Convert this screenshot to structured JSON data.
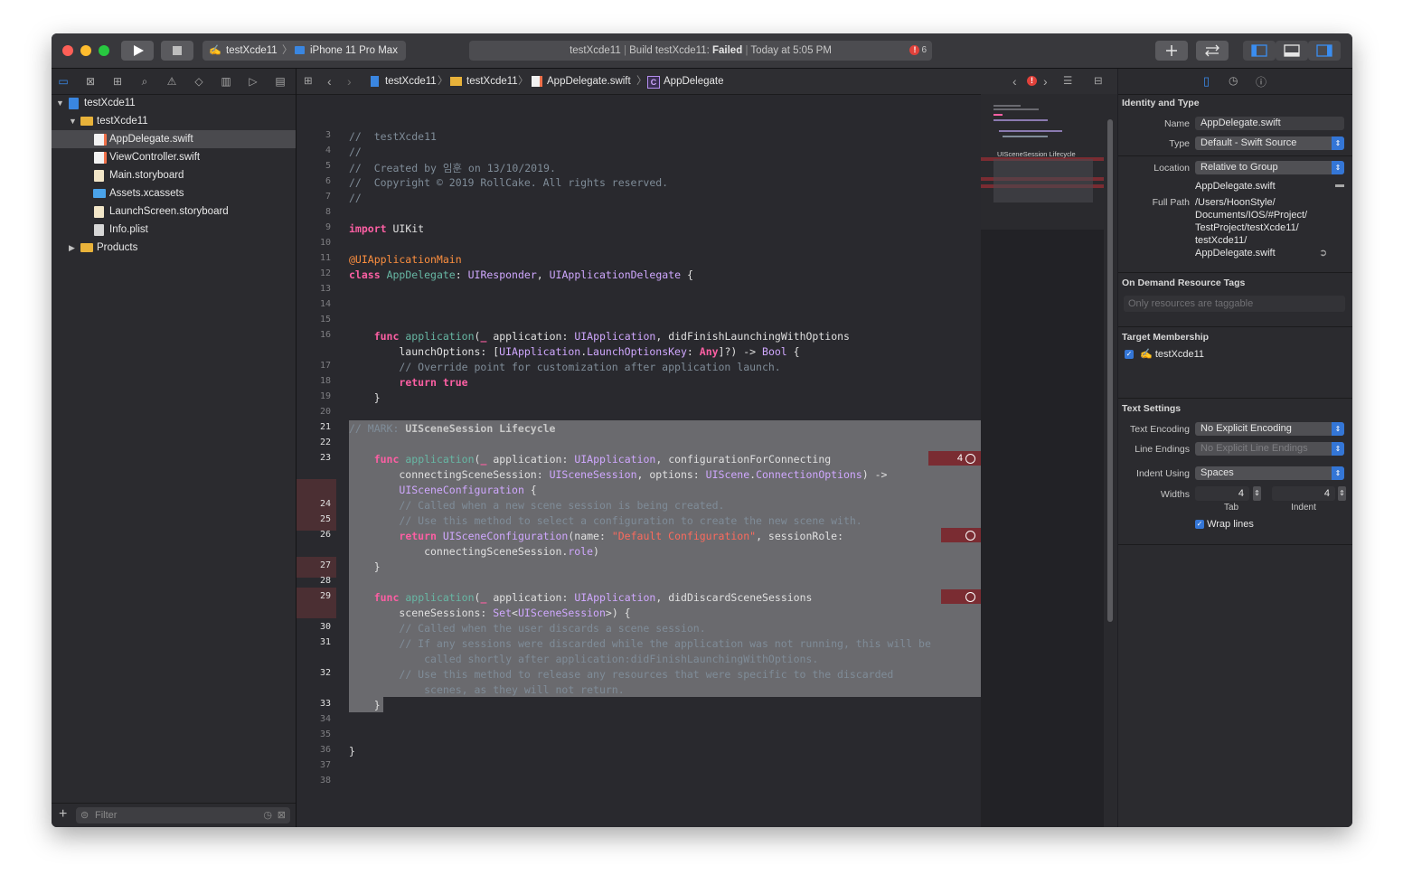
{
  "toolbar": {
    "scheme_target": "testXcde11",
    "scheme_device": "iPhone 11 Pro Max",
    "activity_project": "testXcde11",
    "activity_build": "Build testXcde11:",
    "activity_status": "Failed",
    "activity_time": "Today at 5:05 PM",
    "error_count": "6"
  },
  "navigator": {
    "tree": [
      {
        "label": "testXcde11",
        "kind": "project",
        "expanded": true
      },
      {
        "label": "testXcde11",
        "kind": "folder",
        "expanded": true
      },
      {
        "label": "AppDelegate.swift",
        "kind": "swift",
        "selected": true
      },
      {
        "label": "ViewController.swift",
        "kind": "swift"
      },
      {
        "label": "Main.storyboard",
        "kind": "storyboard"
      },
      {
        "label": "Assets.xcassets",
        "kind": "assets"
      },
      {
        "label": "LaunchScreen.storyboard",
        "kind": "storyboard"
      },
      {
        "label": "Info.plist",
        "kind": "plist"
      },
      {
        "label": "Products",
        "kind": "folder",
        "expanded": false
      }
    ],
    "filter_placeholder": "Filter"
  },
  "jumpbar": {
    "crumbs": [
      "testXcde11",
      "testXcde11",
      "AppDelegate.swift",
      "AppDelegate"
    ]
  },
  "editor": {
    "line_numbers": [
      "3",
      "4",
      "5",
      "6",
      "7",
      "8",
      "9",
      "10",
      "11",
      "12",
      "13",
      "14",
      "15",
      "16",
      "17",
      "18",
      "19",
      "20",
      "21",
      "22",
      "23",
      "24",
      "25",
      "26",
      "27",
      "28",
      "29",
      "30",
      "31",
      "32",
      "33",
      "34",
      "35",
      "36",
      "37",
      "38"
    ],
    "error_badge_1": "4",
    "minimap_label": "UISceneSession Lifecycle"
  },
  "inspector": {
    "identity_title": "Identity and Type",
    "name_label": "Name",
    "name_value": "AppDelegate.swift",
    "type_label": "Type",
    "type_value": "Default - Swift Source",
    "location_label": "Location",
    "location_value": "Relative to Group",
    "location_file": "AppDelegate.swift",
    "fullpath_label": "Full Path",
    "fullpath_lines": [
      "/Users/HoonStyle/",
      "Documents/IOS/#Project/",
      "TestProject/testXcde11/",
      "testXcde11/",
      "AppDelegate.swift"
    ],
    "ondemand_title": "On Demand Resource Tags",
    "ondemand_placeholder": "Only resources are taggable",
    "target_title": "Target Membership",
    "target_name": "testXcde11",
    "text_title": "Text Settings",
    "encoding_label": "Text Encoding",
    "encoding_value": "No Explicit Encoding",
    "endings_label": "Line Endings",
    "endings_value": "No Explicit Line Endings",
    "indent_label": "Indent Using",
    "indent_value": "Spaces",
    "widths_label": "Widths",
    "tab_width": "4",
    "indent_width": "4",
    "tab_caption": "Tab",
    "indent_caption": "Indent",
    "wrap_label": "Wrap lines"
  }
}
